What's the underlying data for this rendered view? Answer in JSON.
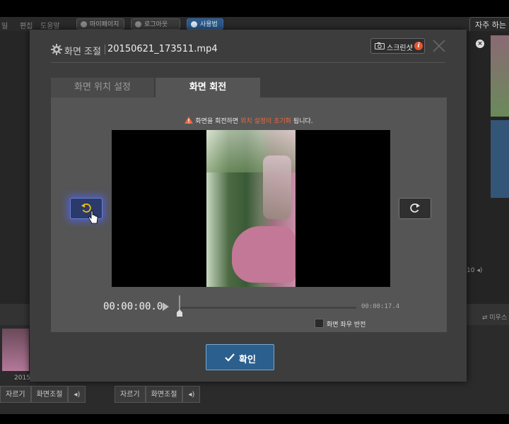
{
  "background": {
    "menu": [
      "일",
      "편집",
      "도움말"
    ],
    "pills": [
      {
        "label": "마이페이지"
      },
      {
        "label": "로그아웃"
      },
      {
        "label": "사용법"
      }
    ],
    "faq_label": "자주 하는",
    "right_volume": "10",
    "swap_label": "미우스",
    "thumb_label": "2015",
    "toolbar1": [
      "자르기",
      "화면조절"
    ],
    "toolbar2": [
      "자르기",
      "화면조절"
    ]
  },
  "dialog": {
    "title": "화면 조절",
    "filename": "20150621_173511.mp4",
    "screenshot_label": "스크린샷",
    "info_badge": "i",
    "tabs": [
      {
        "label": "화면 위치 설정",
        "active": false
      },
      {
        "label": "화면 회전",
        "active": true
      }
    ],
    "warning": {
      "prefix": "화면을 회전하면 ",
      "highlight": "위치 설정이 초기화",
      "suffix": " 됩니다."
    },
    "player": {
      "current_time": "00:00:00.0",
      "duration": "00:00:17.4",
      "progress": 0
    },
    "flip_label": "화면 좌우 반전",
    "flip_checked": false,
    "confirm_label": "확인"
  },
  "colors": {
    "accent": "#2b5f8e",
    "warning_highlight": "#f0693c",
    "info_badge": "#e8552f"
  },
  "icons": [
    "gear-icon",
    "camera-icon",
    "close-icon",
    "warning-icon",
    "rotate-left-icon",
    "rotate-right-icon",
    "play-icon",
    "check-icon",
    "hand-cursor-icon"
  ]
}
